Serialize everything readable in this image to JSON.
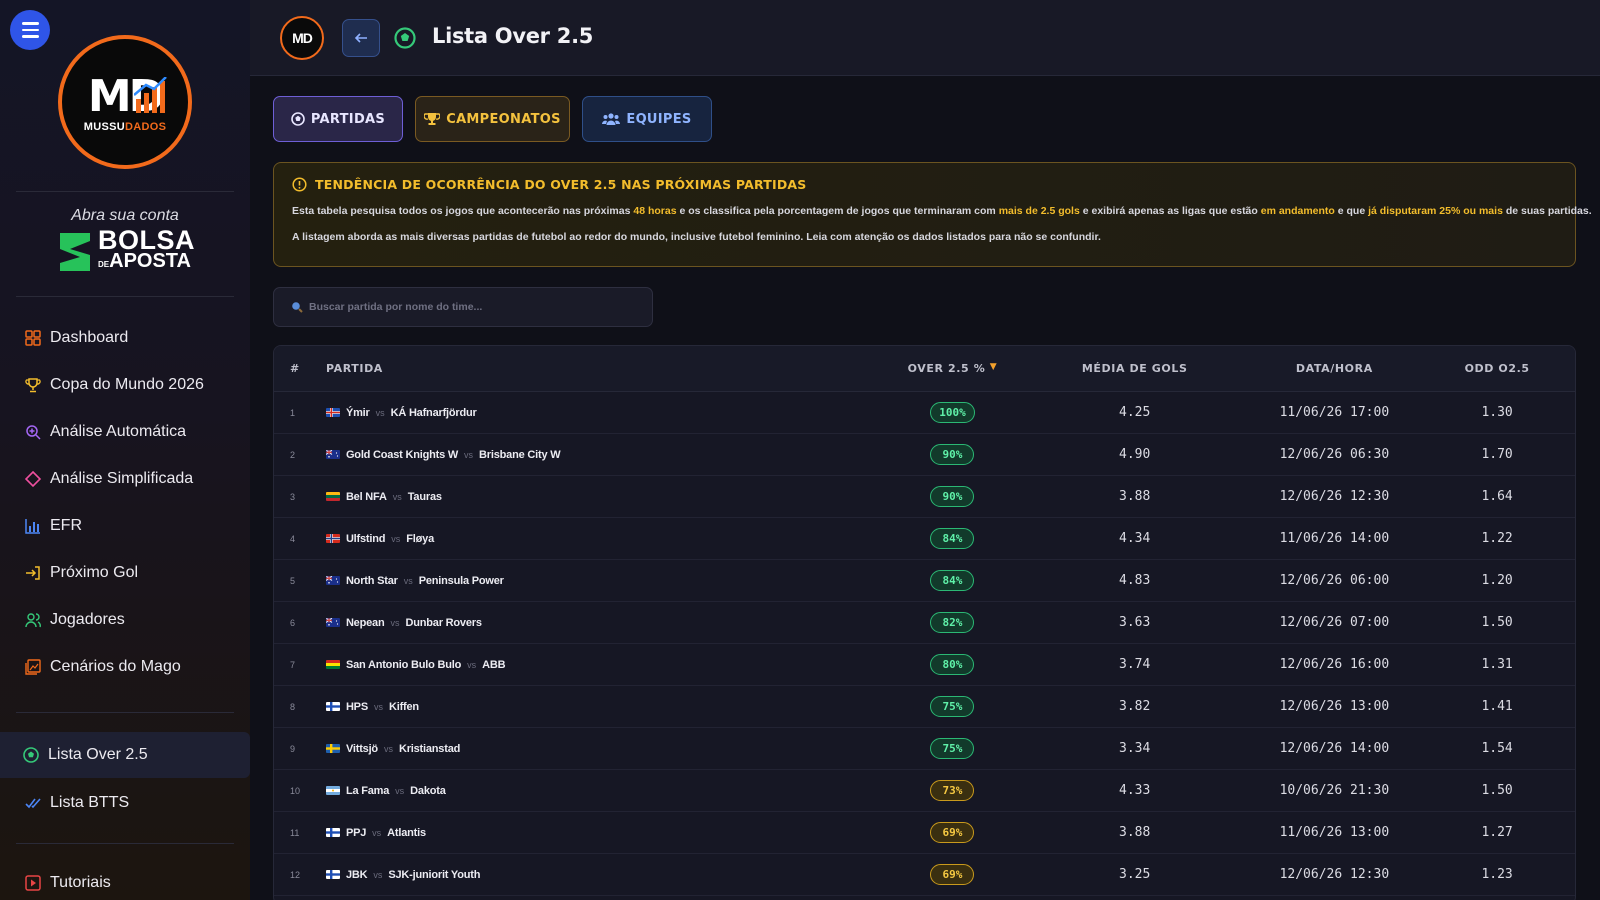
{
  "app": {
    "logo_text": "MD",
    "logo_sub_a": "MUSSU",
    "logo_sub_b": "DADOS"
  },
  "promo": {
    "top": "Abra sua conta",
    "brand_line1": "BOLSA",
    "brand_small": "DE",
    "brand_line2": "APOSTA"
  },
  "sidebar": {
    "items": [
      {
        "label": "Dashboard",
        "icon": "grid-icon"
      },
      {
        "label": "Copa do Mundo 2026",
        "icon": "trophy-icon"
      },
      {
        "label": "Análise Automática",
        "icon": "magnifier-plus-icon"
      },
      {
        "label": "Análise Simplificada",
        "icon": "diamond-icon"
      },
      {
        "label": "EFR",
        "icon": "bar-chart-icon"
      },
      {
        "label": "Próximo Gol",
        "icon": "enter-icon"
      },
      {
        "label": "Jogadores",
        "icon": "users-icon"
      },
      {
        "label": "Cenários do Mago",
        "icon": "image-icon"
      },
      {
        "label": "Lista Over 2.5",
        "icon": "soccer-ball-icon"
      },
      {
        "label": "Lista BTTS",
        "icon": "double-check-icon"
      },
      {
        "label": "Tutoriais",
        "icon": "play-icon"
      }
    ]
  },
  "header": {
    "title": "Lista Over 2.5",
    "back_icon": "arrow-left-icon"
  },
  "tabs": {
    "partidas": "PARTIDAS",
    "campeonatos": "CAMPEONATOS",
    "equipes": "EQUIPES"
  },
  "info": {
    "title": "TENDÊNCIA DE OCORRÊNCIA DO OVER 2.5 NAS PRÓXIMAS PARTIDAS",
    "p1_a": "Esta tabela pesquisa todos os jogos que acontecerão nas próximas ",
    "p1_hl1": "48 horas",
    "p1_b": " e os classifica pela porcentagem de jogos que terminaram com ",
    "p1_hl2": "mais de 2.5 gols",
    "p1_c": " e exibirá apenas as ligas que estão ",
    "p1_hl3": "em andamento",
    "p1_d": " e que ",
    "p1_hl4": "já disputaram 25% ou mais",
    "p1_e": " de suas partidas.",
    "p2": "A listagem aborda as mais diversas partidas de futebol ao redor do mundo, inclusive futebol feminino. Leia com atenção os dados listados para não se confundir."
  },
  "search": {
    "placeholder": "Buscar partida por nome do time..."
  },
  "table": {
    "headers": {
      "num": "#",
      "partida": "PARTIDA",
      "over": "OVER 2.5 %",
      "media": "MÉDIA DE GOLS",
      "data": "DATA/HORA",
      "odd": "ODD O2.5"
    },
    "vs": "vs",
    "rows": [
      {
        "num": "1",
        "home": "Ýmir",
        "away": "KÁ Hafnarfjördur",
        "flag": "iceland",
        "over": "100%",
        "tone": "green",
        "media": "4.25",
        "data": "11/06/26 17:00",
        "odd": "1.30"
      },
      {
        "num": "2",
        "home": "Gold Coast Knights W",
        "away": "Brisbane City W",
        "flag": "australia",
        "over": "90%",
        "tone": "green",
        "media": "4.90",
        "data": "12/06/26 06:30",
        "odd": "1.70"
      },
      {
        "num": "3",
        "home": "Bel NFA",
        "away": "Tauras",
        "flag": "lithuania",
        "over": "90%",
        "tone": "green",
        "media": "3.88",
        "data": "12/06/26 12:30",
        "odd": "1.64"
      },
      {
        "num": "4",
        "home": "Ulfstind",
        "away": "Fløya",
        "flag": "norway",
        "over": "84%",
        "tone": "green",
        "media": "4.34",
        "data": "11/06/26 14:00",
        "odd": "1.22"
      },
      {
        "num": "5",
        "home": "North Star",
        "away": "Peninsula Power",
        "flag": "australia",
        "over": "84%",
        "tone": "green",
        "media": "4.83",
        "data": "12/06/26 06:00",
        "odd": "1.20"
      },
      {
        "num": "6",
        "home": "Nepean",
        "away": "Dunbar Rovers",
        "flag": "australia",
        "over": "82%",
        "tone": "green",
        "media": "3.63",
        "data": "12/06/26 07:00",
        "odd": "1.50"
      },
      {
        "num": "7",
        "home": "San Antonio Bulo Bulo",
        "away": "ABB",
        "flag": "bolivia",
        "over": "80%",
        "tone": "green",
        "media": "3.74",
        "data": "12/06/26 16:00",
        "odd": "1.31"
      },
      {
        "num": "8",
        "home": "HPS",
        "away": "Kiffen",
        "flag": "finland",
        "over": "75%",
        "tone": "green",
        "media": "3.82",
        "data": "12/06/26 13:00",
        "odd": "1.41"
      },
      {
        "num": "9",
        "home": "Vittsjö",
        "away": "Kristianstad",
        "flag": "sweden",
        "over": "75%",
        "tone": "green",
        "media": "3.34",
        "data": "12/06/26 14:00",
        "odd": "1.54"
      },
      {
        "num": "10",
        "home": "La Fama",
        "away": "Dakota",
        "flag": "argentina",
        "over": "73%",
        "tone": "yellow",
        "media": "4.33",
        "data": "10/06/26 21:30",
        "odd": "1.50"
      },
      {
        "num": "11",
        "home": "PPJ",
        "away": "Atlantis",
        "flag": "finland",
        "over": "69%",
        "tone": "yellow",
        "media": "3.88",
        "data": "11/06/26 13:00",
        "odd": "1.27"
      },
      {
        "num": "12",
        "home": "JBK",
        "away": "SJK-juniorit Youth",
        "flag": "finland",
        "over": "69%",
        "tone": "yellow",
        "media": "3.25",
        "data": "12/06/26 12:30",
        "odd": "1.23"
      }
    ]
  }
}
